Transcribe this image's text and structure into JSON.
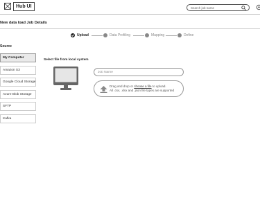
{
  "header": {
    "app_title": "Hub UI",
    "search_placeholder": "Search job name"
  },
  "page": {
    "title": "New data load Job Details"
  },
  "stepper": {
    "steps": [
      {
        "label": "Upload",
        "state": "active"
      },
      {
        "label": "Data Profiling",
        "state": "pending"
      },
      {
        "label": "Mapping",
        "state": "pending"
      },
      {
        "label": "Define",
        "state": "pending"
      }
    ]
  },
  "sources": {
    "title": "Source",
    "items": [
      {
        "label": "My Computer",
        "selected": true
      },
      {
        "label": "Amazon S3",
        "selected": false
      },
      {
        "label": "Google Cloud Storage",
        "selected": false
      },
      {
        "label": "Azure Blob Storage",
        "selected": false
      },
      {
        "label": "SFTP",
        "selected": false
      },
      {
        "label": "Kafka",
        "selected": false
      }
    ]
  },
  "upload": {
    "select_label": "Select file from local system",
    "job_name_placeholder": "Job Name",
    "drop_text_before": "Drag and drop or",
    "drop_link": "choose a file",
    "drop_text_after": "to upload.",
    "supported_text": "All .csv, .xlsx and .json file types are supported"
  },
  "icons": {
    "logo": "image-placeholder-icon",
    "search": "search-icon",
    "settings": "gear-icon",
    "monitor": "monitor-icon",
    "upload": "upload-icon",
    "step_done": "check-circle-icon"
  }
}
